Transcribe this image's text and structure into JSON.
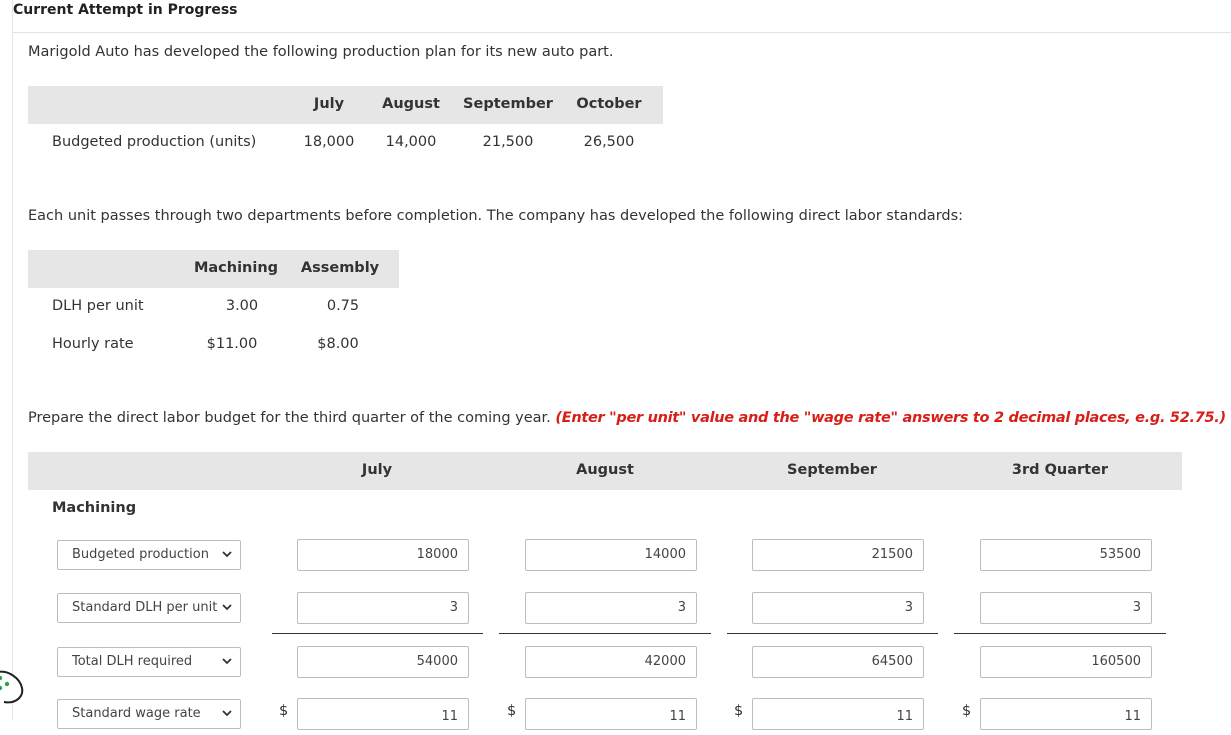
{
  "header": {
    "title": "Current Attempt in Progress"
  },
  "intro": "Marigold Auto has developed the following production plan for its new auto part.",
  "production_plan": {
    "months": [
      "July",
      "August",
      "September",
      "October"
    ],
    "row_label": "Budgeted production (units)",
    "values": [
      "18,000",
      "14,000",
      "21,500",
      "26,500"
    ]
  },
  "departments_text": "Each unit passes through two departments before completion. The company has developed the following direct labor standards:",
  "standards": {
    "columns": [
      "Machining",
      "Assembly"
    ],
    "rows": [
      {
        "label": "DLH per unit",
        "values": [
          "3.00",
          "0.75"
        ]
      },
      {
        "label": "Hourly rate",
        "values": [
          "$11.00",
          "$8.00"
        ]
      }
    ]
  },
  "instruction": {
    "text": "Prepare the direct labor budget for the third quarter of the coming year.",
    "note": "(Enter \"per unit\" value and the \"wage rate\" answers to 2 decimal places, e.g. 52.75.)"
  },
  "budget": {
    "columns": [
      "July",
      "August",
      "September",
      "3rd Quarter"
    ],
    "section_label": "Machining",
    "currency_symbol": "$",
    "rows": [
      {
        "select": "Budgeted production",
        "values": [
          "18000",
          "14000",
          "21500",
          "53500"
        ]
      },
      {
        "select": "Standard DLH per unit",
        "values": [
          "3",
          "3",
          "3",
          "3"
        ]
      },
      {
        "select": "Total DLH required",
        "values": [
          "54000",
          "42000",
          "64500",
          "160500"
        ]
      },
      {
        "select": "Standard wage rate",
        "values": [
          "11",
          "11",
          "11",
          "11"
        ]
      }
    ]
  },
  "colors": {
    "accent_red": "#d91e18",
    "header_bar": "#e6e6e6"
  }
}
